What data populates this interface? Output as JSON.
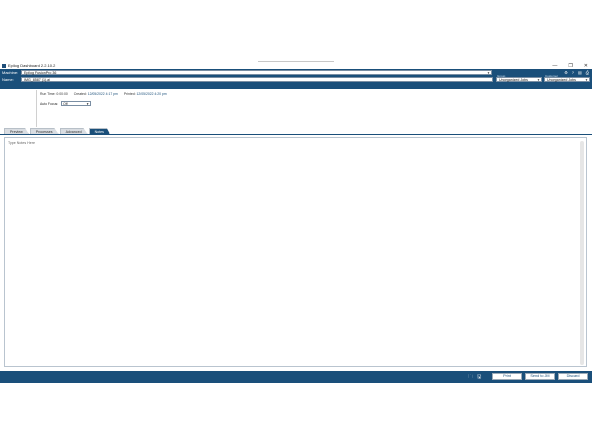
{
  "window": {
    "title": "Epilog Dashboard 2.2.10.2",
    "controls": {
      "minimize": "—",
      "restore": "❐",
      "close": "✕"
    }
  },
  "header": {
    "machine_label": "Machine:",
    "machine_value": "Epilog FusionPro 36",
    "name_label": "Name:",
    "name_value": "IMG_8587 (1).ai",
    "group_label": "Group",
    "group_value": "Unorganized Jobs",
    "customer_label": "Customer",
    "customer_value": "Unorganized Jobs",
    "toolbar_icons": [
      "settings-icon",
      "help-icon",
      "stats-icon",
      "print-icon"
    ]
  },
  "info": {
    "run_time_label": "Run Time:",
    "run_time_value": "0:00:00",
    "created_label": "Created:",
    "created_value": "12/05/2022 4:17 pm",
    "printed_label": "Printed:",
    "printed_value": "12/05/2022 4:20 pm",
    "autofocus_label": "Auto Focus:",
    "autofocus_value": "Off"
  },
  "tabs": [
    {
      "label": "Preview",
      "active": false
    },
    {
      "label": "Processes",
      "active": false
    },
    {
      "label": "Advanced",
      "active": false
    },
    {
      "label": "Notes",
      "active": true
    }
  ],
  "notes": {
    "placeholder": "Type Notes Here"
  },
  "footer": {
    "print_label": "Print",
    "send_label": "Send to JM",
    "discard_label": "Discard"
  },
  "colors": {
    "brand": "#1a4f7a"
  }
}
